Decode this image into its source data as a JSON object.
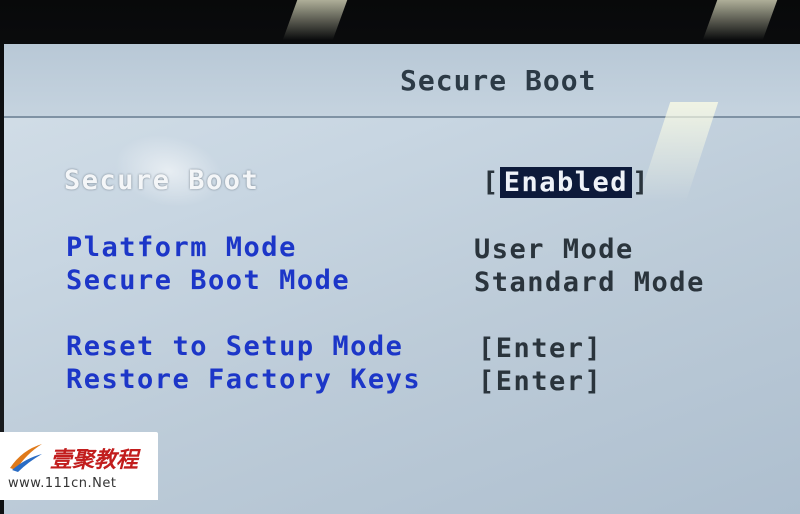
{
  "screen": {
    "title": "Secure Boot"
  },
  "settings": [
    {
      "label": "Secure Boot",
      "value": "Enabled",
      "bracketed": true,
      "selected": true
    },
    {
      "label": "Platform Mode",
      "value": "User Mode",
      "bracketed": false
    },
    {
      "label": "Secure Boot Mode",
      "value": "Standard Mode",
      "bracketed": false
    },
    {
      "label": "Reset to Setup Mode",
      "value": "[Enter]",
      "bracketed": false
    },
    {
      "label": "Restore Factory Keys",
      "value": "[Enter]",
      "bracketed": false
    }
  ],
  "watermark": {
    "brand": "壹聚教程",
    "url": "www.111cn.Net",
    "icon": "swoosh-logo-icon"
  },
  "colors": {
    "accent_blue": "#1c36c8",
    "screen_bg": "#c8d6e2",
    "selected_bg": "#0d1a3a"
  }
}
